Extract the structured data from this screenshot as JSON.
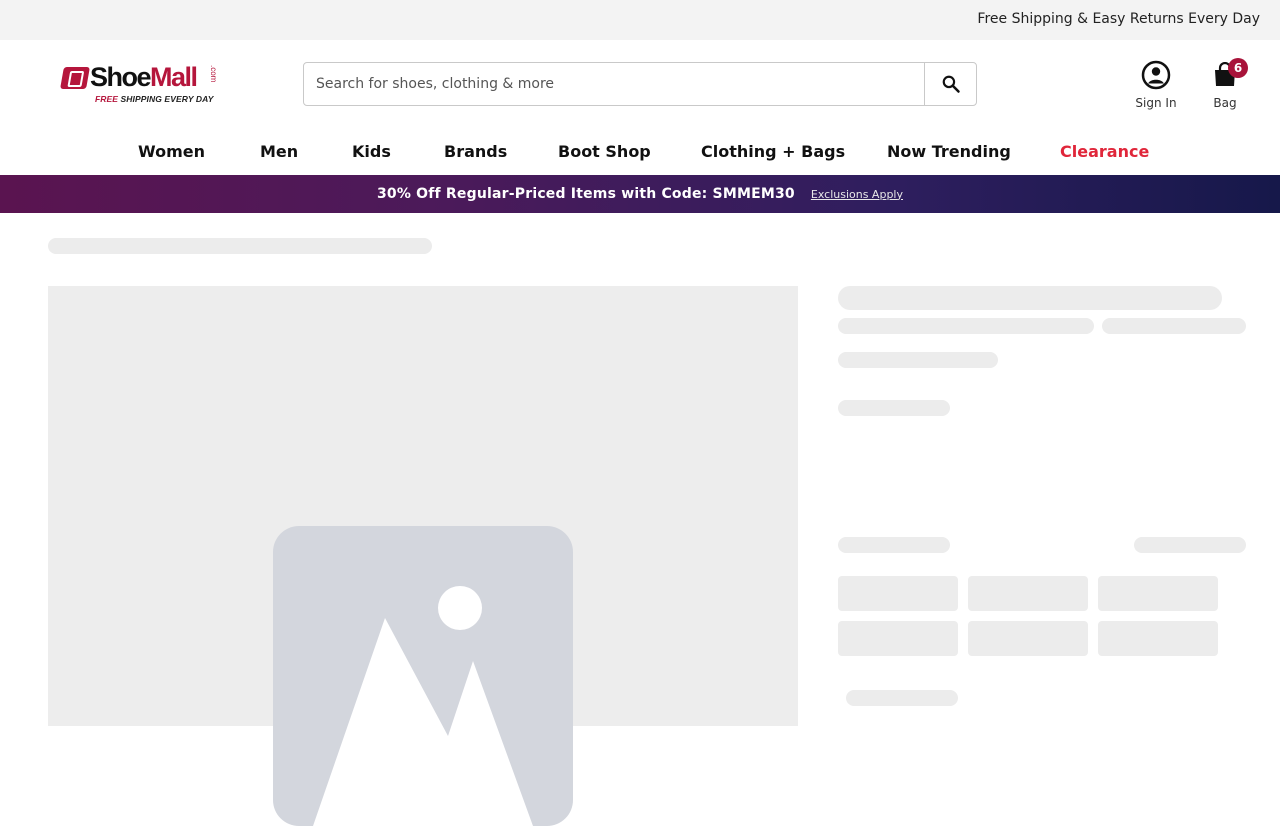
{
  "top_bar": {
    "promo_text": "Free Shipping & Easy Returns Every Day"
  },
  "logo": {
    "brand_shoe": "Shoe",
    "brand_mall": "Mall",
    "brand_tld": ".com",
    "tagline_free": "FREE",
    "tagline_rest": " SHIPPING EVERY DAY",
    "colors": {
      "brand_red": "#b5163c"
    }
  },
  "search": {
    "placeholder": "Search for shoes, clothing & more",
    "value": "",
    "icon": "search-icon"
  },
  "account": {
    "label": "Sign In",
    "icon": "user-circle-icon"
  },
  "bag": {
    "label": "Bag",
    "count": "6",
    "icon": "shopping-bag-icon",
    "badge_color": "#a8133a"
  },
  "nav": {
    "items": [
      {
        "label": "Women"
      },
      {
        "label": "Men"
      },
      {
        "label": "Kids"
      },
      {
        "label": "Brands"
      },
      {
        "label": "Boot Shop"
      },
      {
        "label": "Clothing + Bags"
      },
      {
        "label": "Now Trending"
      },
      {
        "label": "Clearance",
        "color": "#e0263a"
      }
    ]
  },
  "promo_banner": {
    "text": "30% Off Regular-Priced Items with Code: SMMEM30",
    "link": "Exclusions Apply"
  },
  "product": {
    "image_icon": "image-placeholder-icon",
    "loading": true
  }
}
